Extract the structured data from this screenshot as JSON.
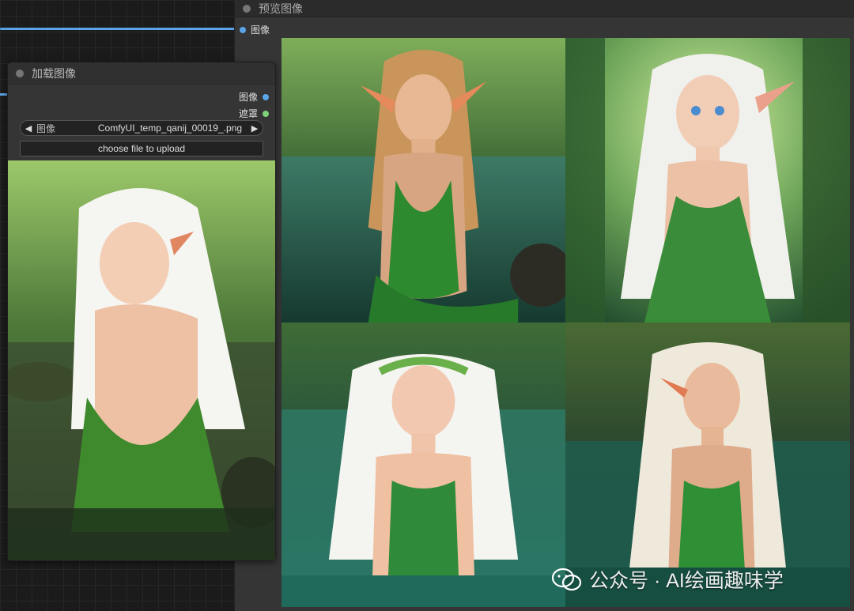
{
  "preview_node": {
    "title": "预览图像",
    "input_label": "图像"
  },
  "load_node": {
    "title": "加载图像",
    "outputs": [
      {
        "label": "图像",
        "color": "#5aa4e8"
      },
      {
        "label": "遮罩",
        "color": "#7fd07a"
      }
    ],
    "image_combo": {
      "label": "图像",
      "value": "ComfyUI_temp_qanij_00019_.png"
    },
    "upload_button": "choose file to upload"
  },
  "preview_images": [
    {
      "name": "elf-blonde-river",
      "hair_color": "#c9955a",
      "dress_color": "#2e8a2e"
    },
    {
      "name": "elf-white-hair-forest",
      "hair_color": "#f0f0ec",
      "dress_color": "#3a8c3a"
    },
    {
      "name": "elf-flower-crown-lake",
      "hair_color": "#f4f4f0",
      "dress_color": "#2f8b3a"
    },
    {
      "name": "elf-white-hair-water",
      "hair_color": "#efe9dc",
      "dress_color": "#2f8f35"
    }
  ],
  "loaded_image": {
    "name": "elf-back-view-stream",
    "hair_color": "#f5f5f2",
    "dress_color": "#3e8a2c"
  },
  "watermark": "公众号 · AI绘画趣味学",
  "colors": {
    "link": "#5aa4e8",
    "node_bg": "#353535",
    "canvas_bg": "#1b1b1b"
  }
}
